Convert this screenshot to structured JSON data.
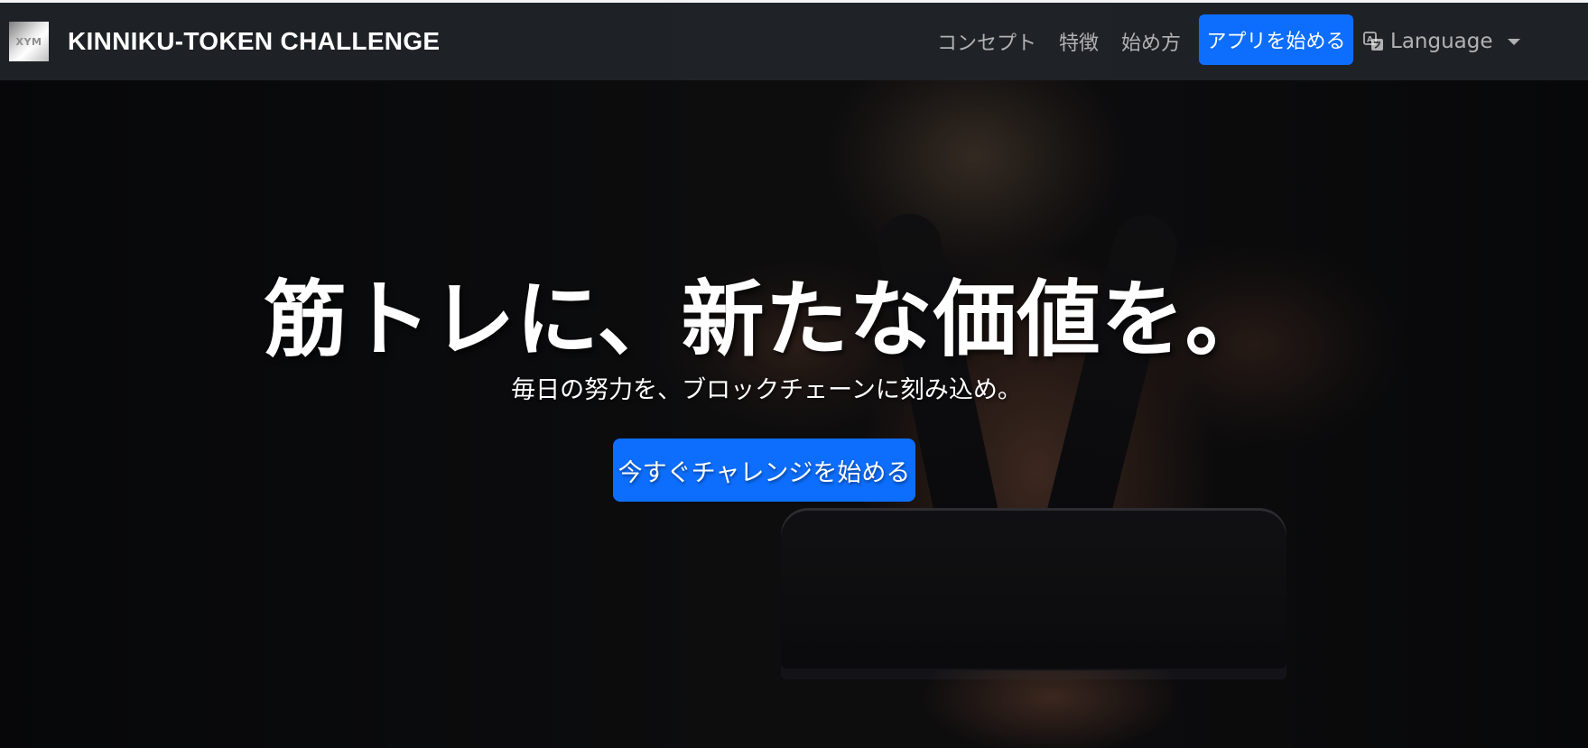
{
  "navbar": {
    "brand_logo_text": "XYM",
    "brand_title": "KINNIKU-TOKEN CHALLENGE",
    "links": [
      {
        "label": "コンセプト"
      },
      {
        "label": "特徴"
      },
      {
        "label": "始め方"
      }
    ],
    "start_app_label": "アプリを始める",
    "language_label": "Language"
  },
  "hero": {
    "title": "筋トレに、新たな価値を。",
    "subtitle": "毎日の努力を、ブロックチェーンに刻み込め。",
    "cta_label": "今すぐチャレンジを始める"
  },
  "colors": {
    "navbar_bg": "#212529",
    "primary": "#0d6efd",
    "text": "#ffffff"
  },
  "icons": {
    "language": "translate-icon",
    "dropdown": "caret-down-icon"
  }
}
